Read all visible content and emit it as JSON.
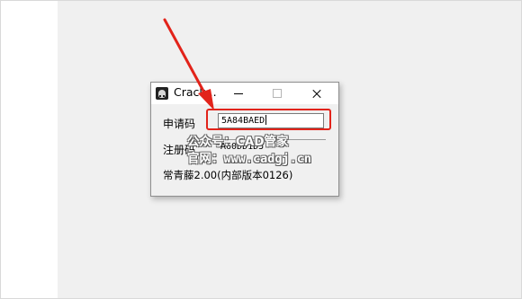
{
  "window": {
    "title": "Crack...",
    "request_code_label": "申请码",
    "request_code_value": "5A84BAED",
    "register_code_label": "注册码",
    "register_code_value": "A60DD1D5",
    "version_text": "常青藤2.00(内部版本0126)"
  },
  "watermark": {
    "line1": "公众号：CAD管家",
    "line2": "官网：www.cadgj.cn"
  },
  "annotation": {
    "color": "#e2231a"
  }
}
